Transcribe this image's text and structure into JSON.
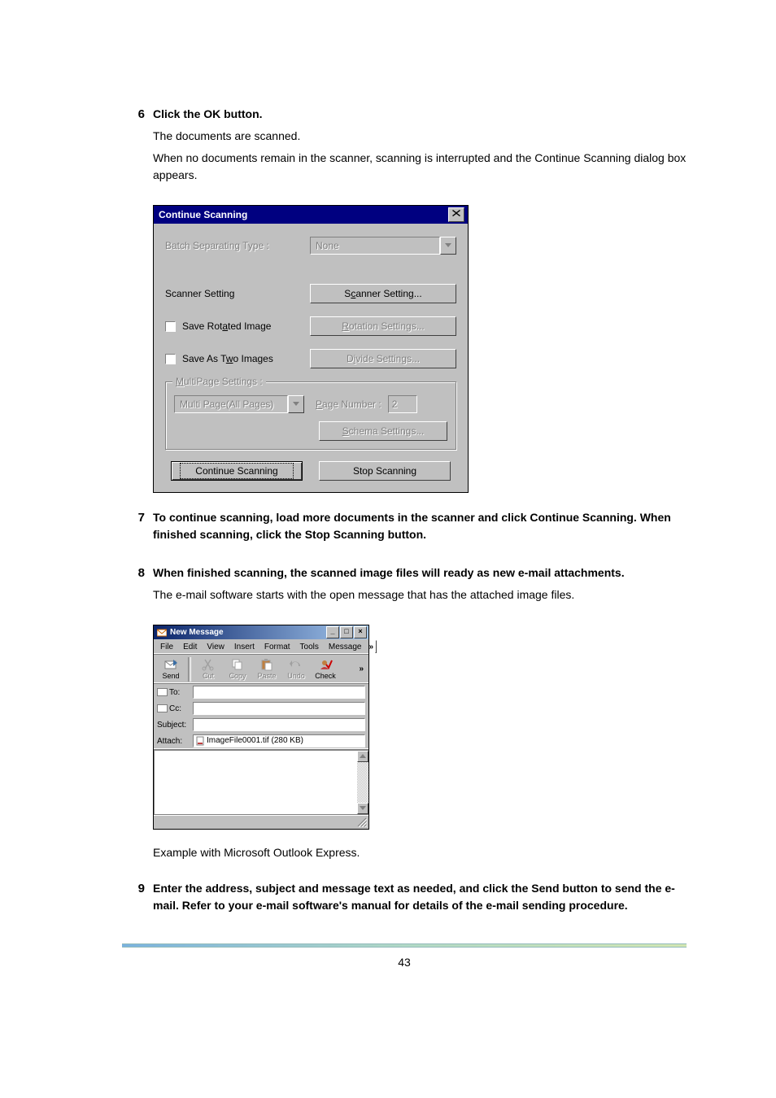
{
  "steps": {
    "s6": {
      "num": "6",
      "title": "Click the OK button.",
      "line1": "The documents are scanned.",
      "line2": "When no documents remain in the scanner, scanning is interrupted and the Continue Scanning dialog box appears."
    },
    "s7": {
      "num": "7",
      "title": "To continue scanning, load more documents in the scanner and click Continue Scanning. When finished scanning, click the Stop Scanning button."
    },
    "s8": {
      "num": "8",
      "title": "When finished scanning, the scanned image files will ready as new e-mail attachments.",
      "line1": "The e-mail software starts with the open message that has the attached image files."
    },
    "s8_caption": "Example with Microsoft Outlook Express.",
    "s9": {
      "num": "9",
      "title": "Enter the address, subject and message text as needed, and click the Send button to send the e-mail. Refer to your e-mail software's manual for details of the e-mail sending procedure."
    }
  },
  "dlg": {
    "title": "Continue Scanning",
    "batchLabel_pre": "Batch Separating Type :",
    "batchValue": "None",
    "scannerLabel": "Scanner Setting",
    "scannerBtn_pre": "S",
    "scannerBtn_u": "c",
    "scannerBtn_post": "anner Setting...",
    "saveRotated_pre": "Save Rot",
    "saveRotated_u": "a",
    "saveRotated_post": "ted Image",
    "rotationBtn_u": "R",
    "rotationBtn_post": "otation Settings...",
    "saveTwo_pre": "Save As T",
    "saveTwo_u": "w",
    "saveTwo_post": "o Images",
    "divideBtn_pre": "D",
    "divideBtn_u": "i",
    "divideBtn_post": "vide Settings...",
    "group_u": "M",
    "group_post": "ultiPage Settings :",
    "multiCombo": "Multi Page(All Pages)",
    "pageNum_u": "P",
    "pageNum_post": "age Number :",
    "pageNumValue": "2",
    "schema_u": "S",
    "schema_post": "chema Settings...",
    "continueBtn": "Continue Scanning",
    "stopBtn": "Stop Scanning"
  },
  "oe": {
    "title": "New Message",
    "menu": {
      "file": "File",
      "edit": "Edit",
      "view": "View",
      "insert": "Insert",
      "format": "Format",
      "tools": "Tools",
      "message": "Message",
      "more": "»"
    },
    "tools": {
      "send": "Send",
      "cut": "Cut",
      "copy": "Copy",
      "paste": "Paste",
      "undo": "Undo",
      "check": "Check",
      "more": "»"
    },
    "fields": {
      "to": "To:",
      "cc": "Cc:",
      "subject": "Subject:",
      "attach": "Attach:",
      "attachValue": "ImageFile0001.tif (280 KB)"
    }
  },
  "pageNumber": "43"
}
